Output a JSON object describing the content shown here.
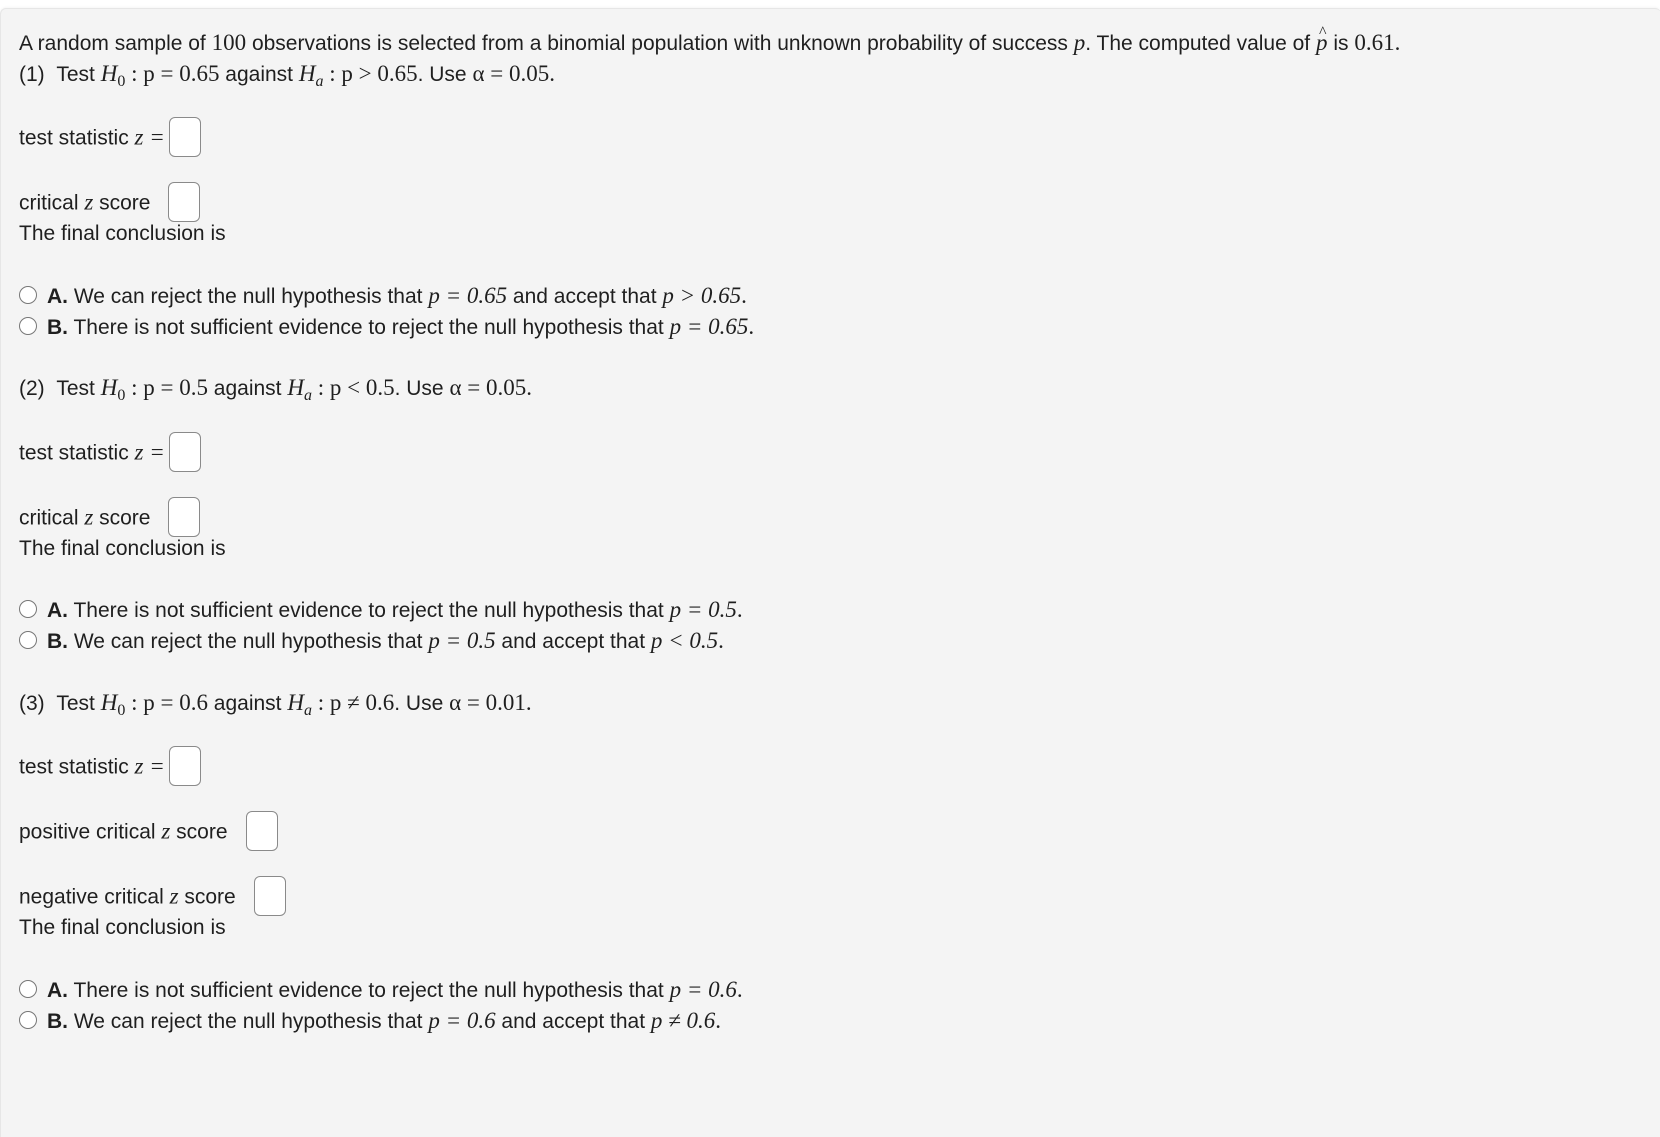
{
  "intro": {
    "text_a": "A random sample of ",
    "n": "100",
    "text_b": " observations is selected from a binomial population with unknown probability of success ",
    "p_symbol": "p",
    "text_c": ". The computed value of ",
    "phat_symbol": "p",
    "text_d": " is ",
    "phat_value": "0.61",
    "text_e": "."
  },
  "parts": [
    {
      "number": "(1)",
      "test_word": "Test ",
      "h0_label": "H",
      "h0_sub": "0",
      "h0_expr": " : p = 0.65",
      "against": " against ",
      "ha_label": "H",
      "ha_sub": "a",
      "ha_expr": " : p > 0.65",
      "use": ". Use ",
      "alpha_expr": "α = 0.05",
      "end": ".",
      "test_stat_label": "test statistic ",
      "test_stat_math": "z =",
      "critical_label_a": "critical ",
      "critical_label_z": "z",
      "critical_label_b": " score",
      "conclusion_label": "The final conclusion is",
      "options": [
        {
          "letter": "A.",
          "text_a": " We can reject the null hypothesis that ",
          "math_a": "p = 0.65",
          "text_b": " and accept that ",
          "math_b": "p > 0.65",
          "text_c": "."
        },
        {
          "letter": "B.",
          "text_a": " There is not sufficient evidence to reject the null hypothesis that ",
          "math_a": "p = 0.65",
          "text_b": "",
          "math_b": "",
          "text_c": "."
        }
      ]
    },
    {
      "number": "(2)",
      "test_word": "Test ",
      "h0_label": "H",
      "h0_sub": "0",
      "h0_expr": " : p = 0.5",
      "against": " against ",
      "ha_label": "H",
      "ha_sub": "a",
      "ha_expr": " : p < 0.5",
      "use": ". Use ",
      "alpha_expr": "α = 0.05",
      "end": ".",
      "test_stat_label": "test statistic ",
      "test_stat_math": "z =",
      "critical_label_a": "critical ",
      "critical_label_z": "z",
      "critical_label_b": " score",
      "conclusion_label": "The final conclusion is",
      "options": [
        {
          "letter": "A.",
          "text_a": " There is not sufficient evidence to reject the null hypothesis that ",
          "math_a": "p = 0.5",
          "text_b": "",
          "math_b": "",
          "text_c": "."
        },
        {
          "letter": "B.",
          "text_a": " We can reject the null hypothesis that ",
          "math_a": "p = 0.5",
          "text_b": " and accept that ",
          "math_b": "p < 0.5",
          "text_c": "."
        }
      ]
    },
    {
      "number": "(3)",
      "test_word": "Test ",
      "h0_label": "H",
      "h0_sub": "0",
      "h0_expr": " : p = 0.6",
      "against": " against ",
      "ha_label": "H",
      "ha_sub": "a",
      "ha_expr": " : p ≠ 0.6",
      "use": ". Use ",
      "alpha_expr": "α = 0.01",
      "end": ".",
      "test_stat_label": "test statistic ",
      "test_stat_math": "z =",
      "pos_critical_label_a": "positive critical ",
      "neg_critical_label_a": "negative critical ",
      "critical_label_z": "z",
      "critical_label_b": " score",
      "conclusion_label": "The final conclusion is",
      "options": [
        {
          "letter": "A.",
          "text_a": " There is not sufficient evidence to reject the null hypothesis that ",
          "math_a": "p = 0.6",
          "text_b": "",
          "math_b": "",
          "text_c": "."
        },
        {
          "letter": "B.",
          "text_a": " We can reject the null hypothesis that ",
          "math_a": "p = 0.6",
          "text_b": " and accept that ",
          "math_b": "p ≠ 0.6",
          "text_c": "."
        }
      ]
    }
  ],
  "inputs": {
    "part1_test_statistic": "",
    "part1_critical": "",
    "part2_test_statistic": "",
    "part2_critical": "",
    "part3_test_statistic": "",
    "part3_pos_critical": "",
    "part3_neg_critical": ""
  }
}
